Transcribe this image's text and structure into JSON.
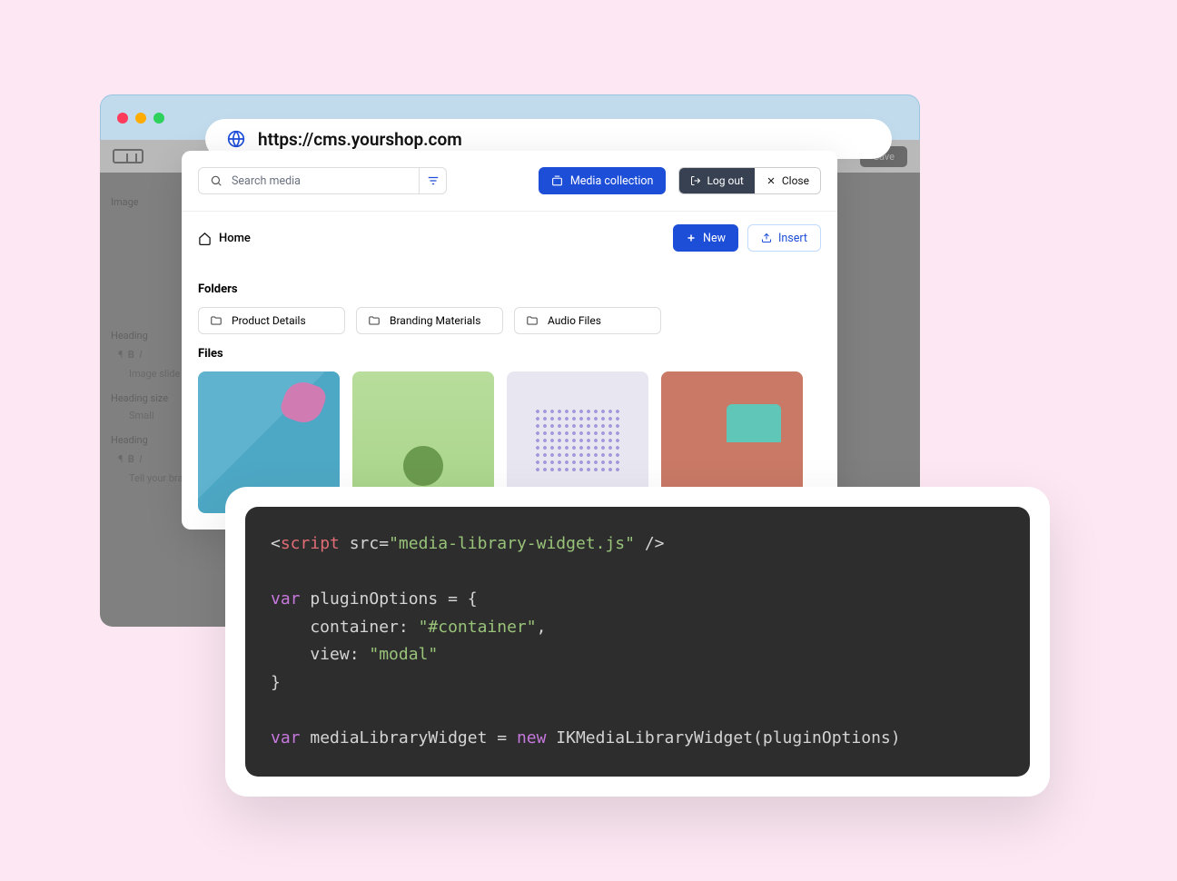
{
  "browser": {
    "url": "https://cms.yourshop.com"
  },
  "cms_back": {
    "save": "Save",
    "image": "Image",
    "heading": "Heading",
    "image_slide": "Image slide",
    "heading_size": "Heading size",
    "small": "Small",
    "tell_brand": "Tell your bran"
  },
  "modal": {
    "search_placeholder": "Search media",
    "media_collection": "Media collection",
    "logout": "Log out",
    "close": "Close",
    "breadcrumb": "Home",
    "new_btn": "New",
    "insert_btn": "Insert",
    "folders_title": "Folders",
    "folders": [
      {
        "label": "Product Details"
      },
      {
        "label": "Branding Materials"
      },
      {
        "label": "Audio Files"
      }
    ],
    "files_title": "Files"
  },
  "code": {
    "line1_open": "<",
    "line1_tag": "script",
    "line1_attr": " src=",
    "line1_str": "\"media-library-widget.js\"",
    "line1_close": " />",
    "line3_kw": "var",
    "line3_rest": " pluginOptions = {",
    "line4_prop": "    container: ",
    "line4_val": "\"#container\"",
    "line4_comma": ",",
    "line5_prop": "    view: ",
    "line5_val": "\"modal\"",
    "line6": "}",
    "line8_kw": "var",
    "line8_mid": " mediaLibraryWidget = ",
    "line8_new": "new",
    "line8_call": " IKMediaLibraryWidget(pluginOptions)"
  }
}
